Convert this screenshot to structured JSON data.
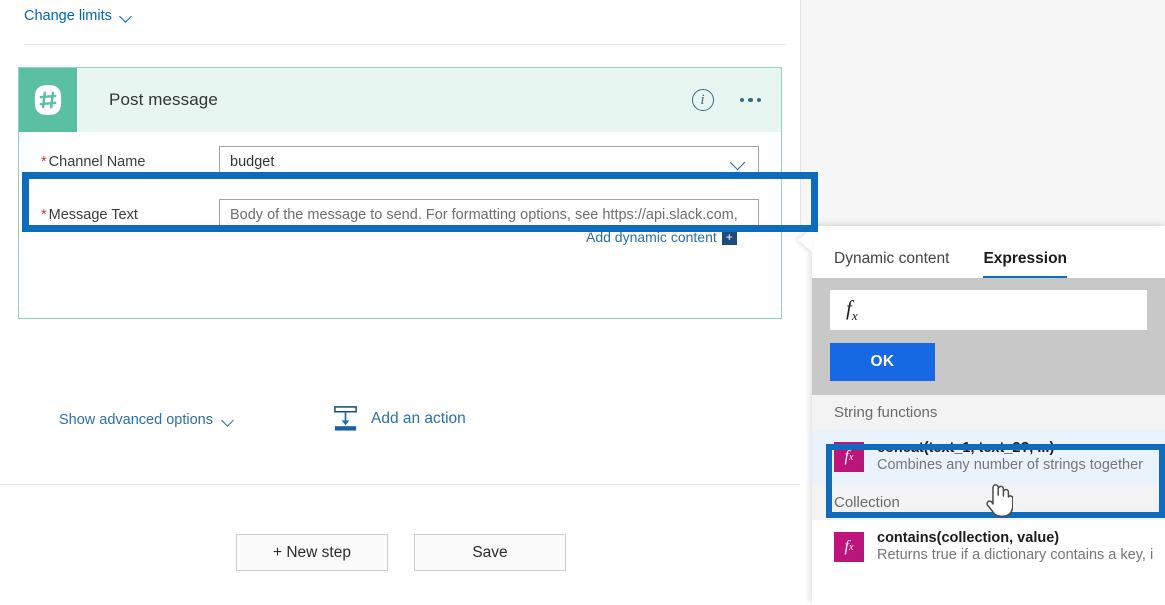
{
  "designer": {
    "change_limits": {
      "label": "Change limits",
      "icon": "chevron-down-icon"
    },
    "card": {
      "title": "Post message",
      "connector_icon": "slack-hash-icon",
      "info_icon": "info-circle-icon",
      "more_icon": "ellipsis-icon",
      "fields": [
        {
          "label": "Channel Name",
          "required": true,
          "type": "dropdown",
          "value": "budget",
          "placeholder": "",
          "chevron_icon": "chevron-down-icon"
        },
        {
          "label": "Message Text",
          "required": true,
          "type": "text",
          "value": "",
          "placeholder": "Body of the message to send. For formatting options, see https://api.slack.com,"
        }
      ],
      "add_dynamic_content": {
        "label": "Add dynamic content",
        "plus": "+"
      },
      "show_advanced": {
        "label": "Show advanced options",
        "icon": "chevron-down-icon"
      }
    },
    "add_an_action": {
      "label": "Add an action",
      "icon": "insert-step-icon"
    },
    "buttons": {
      "new_step": "+ New step",
      "save": "Save"
    }
  },
  "expression_panel": {
    "tabs": [
      {
        "label": "Dynamic content",
        "active": false
      },
      {
        "label": "Expression",
        "active": true
      }
    ],
    "editor": {
      "fx_symbol": "fx",
      "value": "",
      "ok_label": "OK"
    },
    "groups": [
      {
        "header": "String functions",
        "items": [
          {
            "icon": "fx-icon",
            "signature": "concat(text_1, text_2?, ...)",
            "description": "Combines any number of strings together",
            "selected": true
          }
        ]
      },
      {
        "header": "Collection",
        "items": [
          {
            "icon": "fx-icon",
            "signature": "contains(collection, value)",
            "description": "Returns true if a dictionary contains a key, i",
            "selected": false
          }
        ]
      }
    ]
  },
  "annotations": {
    "highlight_color": "#0f6cbd",
    "message_text_highlight": true,
    "concat_highlight": true,
    "cursor": "pointing-hand-cursor"
  },
  "colors": {
    "accent_blue": "#0f6cbd",
    "link_blue": "#2a6fa8",
    "slack_teal": "#5bbfa2",
    "card_header_bg": "#e8f6f2",
    "fx_magenta": "#bf1f7d",
    "ok_blue": "#1668e3"
  }
}
